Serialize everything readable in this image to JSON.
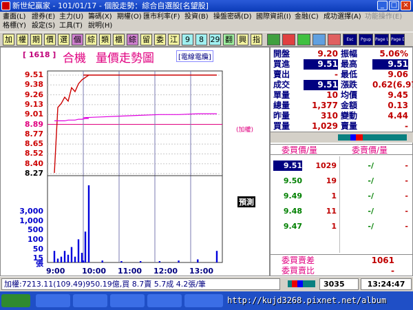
{
  "window": {
    "title": "新世紀贏家 - 101/01/17 - 個股走勢：綜合自選股[名望股]",
    "buttons": [
      "_",
      "□",
      "×"
    ]
  },
  "menu": {
    "row1": [
      {
        "label": "畫面(L)",
        "enabled": true
      },
      {
        "label": "證券(E)",
        "enabled": true
      },
      {
        "label": "主力(U)",
        "enabled": true
      },
      {
        "label": "籌碼(X)",
        "enabled": true
      },
      {
        "label": "期權(O)",
        "enabled": true
      },
      {
        "label": "匯市利率(F)",
        "enabled": true
      },
      {
        "label": "投資(B)",
        "enabled": true
      },
      {
        "label": "操盤密碼(D)",
        "enabled": true
      },
      {
        "label": "國際資訊(I)",
        "enabled": true
      },
      {
        "label": "金融(C)",
        "enabled": true
      },
      {
        "label": "成功選擇(A)",
        "enabled": true
      },
      {
        "label": "功能操作(E)",
        "enabled": false
      }
    ],
    "row2": [
      {
        "label": "格標(Y)",
        "enabled": true
      },
      {
        "label": "設定(S)",
        "enabled": true
      },
      {
        "label": "工具(T)",
        "enabled": true
      },
      {
        "label": "說明(H)",
        "enabled": true
      }
    ]
  },
  "toolbar": {
    "items": [
      {
        "label": "加",
        "bg": "#f3f3a0"
      },
      {
        "label": "權",
        "bg": "#f3f3a0"
      },
      {
        "label": "期",
        "bg": "#f3f3a0"
      },
      {
        "label": "價",
        "bg": "#f3f3a0"
      },
      {
        "label": "選",
        "bg": "#f3f3a0"
      },
      {
        "label": "個",
        "bg": "#d080d0"
      },
      {
        "label": "綜",
        "bg": "#f3f3a0"
      },
      {
        "label": "類",
        "bg": "#f3f3a0"
      },
      {
        "label": "櫃",
        "bg": "#f3f3a0"
      },
      {
        "label": "綜",
        "bg": "#d080d0"
      },
      {
        "label": "留",
        "bg": "#f3f3a0"
      },
      {
        "label": "委",
        "bg": "#f3f3a0"
      },
      {
        "label": "江",
        "bg": "#f3f3a0"
      },
      {
        "label": "9",
        "bg": "#a0f0f0"
      },
      {
        "label": "8",
        "bg": "#a0f0f0"
      },
      {
        "label": "29",
        "bg": "#a0f0f0"
      },
      {
        "label": "翻",
        "bg": "#a0f0a0"
      },
      {
        "label": "興",
        "bg": "#f3f3a0"
      },
      {
        "label": "指",
        "bg": "#f3f3a0"
      }
    ],
    "icons": [
      "chart-icon",
      "red-chart-icon",
      "grid-icon",
      "table-icon",
      "cross-icon"
    ],
    "text_buttons": [
      "Esc",
      "Pgup",
      "Page Up",
      "Page Dn"
    ]
  },
  "chart": {
    "code": "[ 1618 ]",
    "title": "合機",
    "subtitle": "量價走勢圖",
    "source": "[電線電纜]",
    "volume_unit": "張",
    "index_label": "(加權)",
    "price_labels": [
      {
        "v": "9.51",
        "color": "#cc0000"
      },
      {
        "v": "9.38",
        "color": "#cc0000"
      },
      {
        "v": "9.26",
        "color": "#cc0000"
      },
      {
        "v": "9.13",
        "color": "#cc0000"
      },
      {
        "v": "9.01",
        "color": "#cc0000"
      },
      {
        "v": "8.89",
        "color": "#e00080"
      },
      {
        "v": "8.77",
        "color": "#cc0000"
      },
      {
        "v": "8.65",
        "color": "#cc0000"
      },
      {
        "v": "8.52",
        "color": "#cc0000"
      },
      {
        "v": "8.40",
        "color": "#cc0000"
      },
      {
        "v": "8.27",
        "color": "#000000"
      }
    ],
    "volume_labels": [
      "3,000",
      "1,000",
      "500",
      "100",
      "50",
      "15"
    ],
    "time_labels": [
      "9:00",
      "10:00",
      "11:00",
      "12:00",
      "13:00"
    ],
    "watermark_box": "預測"
  },
  "chart_data": {
    "type": "line",
    "x": [
      "9:00",
      "9:05",
      "9:10",
      "9:15",
      "9:20",
      "9:25",
      "9:30",
      "9:35",
      "9:40",
      "9:45",
      "9:50",
      "10:00",
      "10:30",
      "11:00",
      "11:30",
      "12:00",
      "12:30",
      "13:00",
      "13:30"
    ],
    "series": [
      {
        "values": [
          8.27,
          9.1,
          9.15,
          9.23,
          9.18,
          9.35,
          9.3,
          9.4,
          9.45,
          9.48,
          9.51,
          9.51,
          9.51,
          9.51,
          9.51,
          9.51,
          9.51,
          9.51,
          9.51
        ],
        "color": "#cc0000"
      },
      {
        "values": [
          8.93,
          8.93,
          8.93,
          8.93,
          8.94,
          8.94,
          8.94,
          8.95,
          8.95,
          8.96,
          8.96,
          8.97,
          8.98,
          8.99,
          9.0,
          9.01,
          9.01,
          9.02,
          9.02
        ],
        "color": "#e000e0"
      }
    ],
    "volume": [
      30,
      10,
      15,
      30,
      20,
      40,
      15,
      60,
      25,
      80,
      200,
      5,
      5,
      3,
      3,
      3,
      5,
      8,
      30
    ],
    "ylim": [
      8.27,
      9.51
    ],
    "grid": true
  },
  "quote": {
    "rows": [
      {
        "l": "開盤",
        "v": "9.20",
        "l2": "振幅",
        "v2": "5.06%",
        "hv": false,
        "hv2": false
      },
      {
        "l": "買進",
        "v": "9.51",
        "l2": "最高",
        "v2": "9.51",
        "hv": true,
        "hv2": true
      },
      {
        "l": "賣出",
        "v": "-",
        "l2": "最低",
        "v2": "9.06",
        "hv": false,
        "hv2": false
      },
      {
        "l": "成交",
        "v": "9.51",
        "l2": "漲跌",
        "v2": "0.62(6.97)",
        "hv": true,
        "hv2": false
      },
      {
        "l": "單量",
        "v": "10",
        "l2": "均價",
        "v2": "9.45",
        "hv": false,
        "hv2": false
      },
      {
        "l": "總量",
        "v": "1,377",
        "l2": "金額",
        "v2": "0.13",
        "hv": false,
        "hv2": false
      },
      {
        "l": "昨量",
        "v": "310",
        "l2": "變動",
        "v2": "4.44",
        "hv": false,
        "hv2": false
      },
      {
        "l": "買量",
        "v": "1,029",
        "l2": "賣量",
        "v2": "-",
        "hv": false,
        "hv2": false
      }
    ],
    "bid_header": "委買價/量",
    "ask_header": "委賣價/量",
    "book": [
      {
        "bp": "9.51",
        "bq": "1029",
        "ap": "-/",
        "aq": "-"
      },
      {
        "bp": "9.50",
        "bq": "19",
        "ap": "-/",
        "aq": "-"
      },
      {
        "bp": "9.49",
        "bq": "1",
        "ap": "-/",
        "aq": "-"
      },
      {
        "bp": "9.48",
        "bq": "11",
        "ap": "-/",
        "aq": "-"
      },
      {
        "bp": "9.47",
        "bq": "1",
        "ap": "-/",
        "aq": "-"
      }
    ],
    "diff_label": "委買賣差",
    "diff_value": "1061",
    "ratio_label": "委買賣比",
    "ratio_value": "-"
  },
  "status": {
    "info": "加權:7213.11(109.49)950.19億,買 8.7賣 5.7成 4.2張/筆",
    "code": "3035",
    "clock": "13:24:47"
  },
  "taskbar": {
    "items": [
      "",
      "",
      "",
      "",
      "",
      "",
      ""
    ]
  },
  "watermark": "http://kujd3268.pixnet.net/album"
}
